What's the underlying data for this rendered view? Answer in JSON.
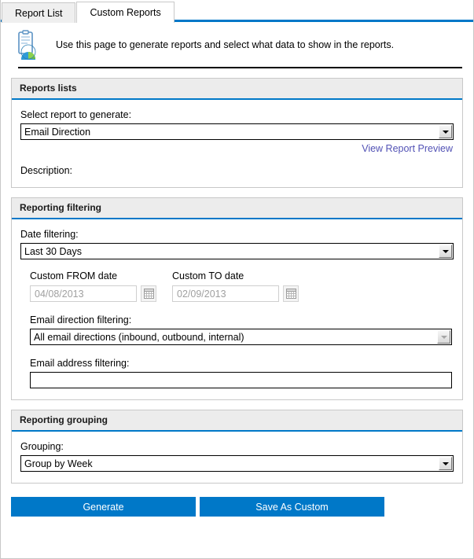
{
  "tabs": [
    {
      "label": "Report List",
      "active": false
    },
    {
      "label": "Custom Reports",
      "active": true
    }
  ],
  "intro": {
    "icon": "report-clipboard-chart-icon",
    "text": "Use this page to generate reports and select what data to show in the reports."
  },
  "sections": {
    "reports_lists": {
      "title": "Reports lists",
      "select_label": "Select report to generate:",
      "select_value": "Email Direction",
      "preview_link": "View Report Preview",
      "description_label": "Description:",
      "description_value": ""
    },
    "reporting_filtering": {
      "title": "Reporting filtering",
      "date_label": "Date filtering:",
      "date_value": "Last 30 Days",
      "custom_from_label": "Custom FROM date",
      "custom_from_value": "04/08/2013",
      "custom_to_label": "Custom TO date",
      "custom_to_value": "02/09/2013",
      "direction_label": "Email direction filtering:",
      "direction_value": "All email directions (inbound, outbound, internal)",
      "address_label": "Email address filtering:",
      "address_value": "",
      "address_placeholder": ""
    },
    "reporting_grouping": {
      "title": "Reporting grouping",
      "grouping_label": "Grouping:",
      "grouping_value": "Group by Week"
    }
  },
  "actions": {
    "generate_label": "Generate",
    "save_label": "Save As Custom"
  },
  "colors": {
    "accent_blue": "#0078c8",
    "section_header_bg": "#ececec",
    "link_purple": "#5252b5",
    "disabled_text": "#a0a0a0"
  }
}
